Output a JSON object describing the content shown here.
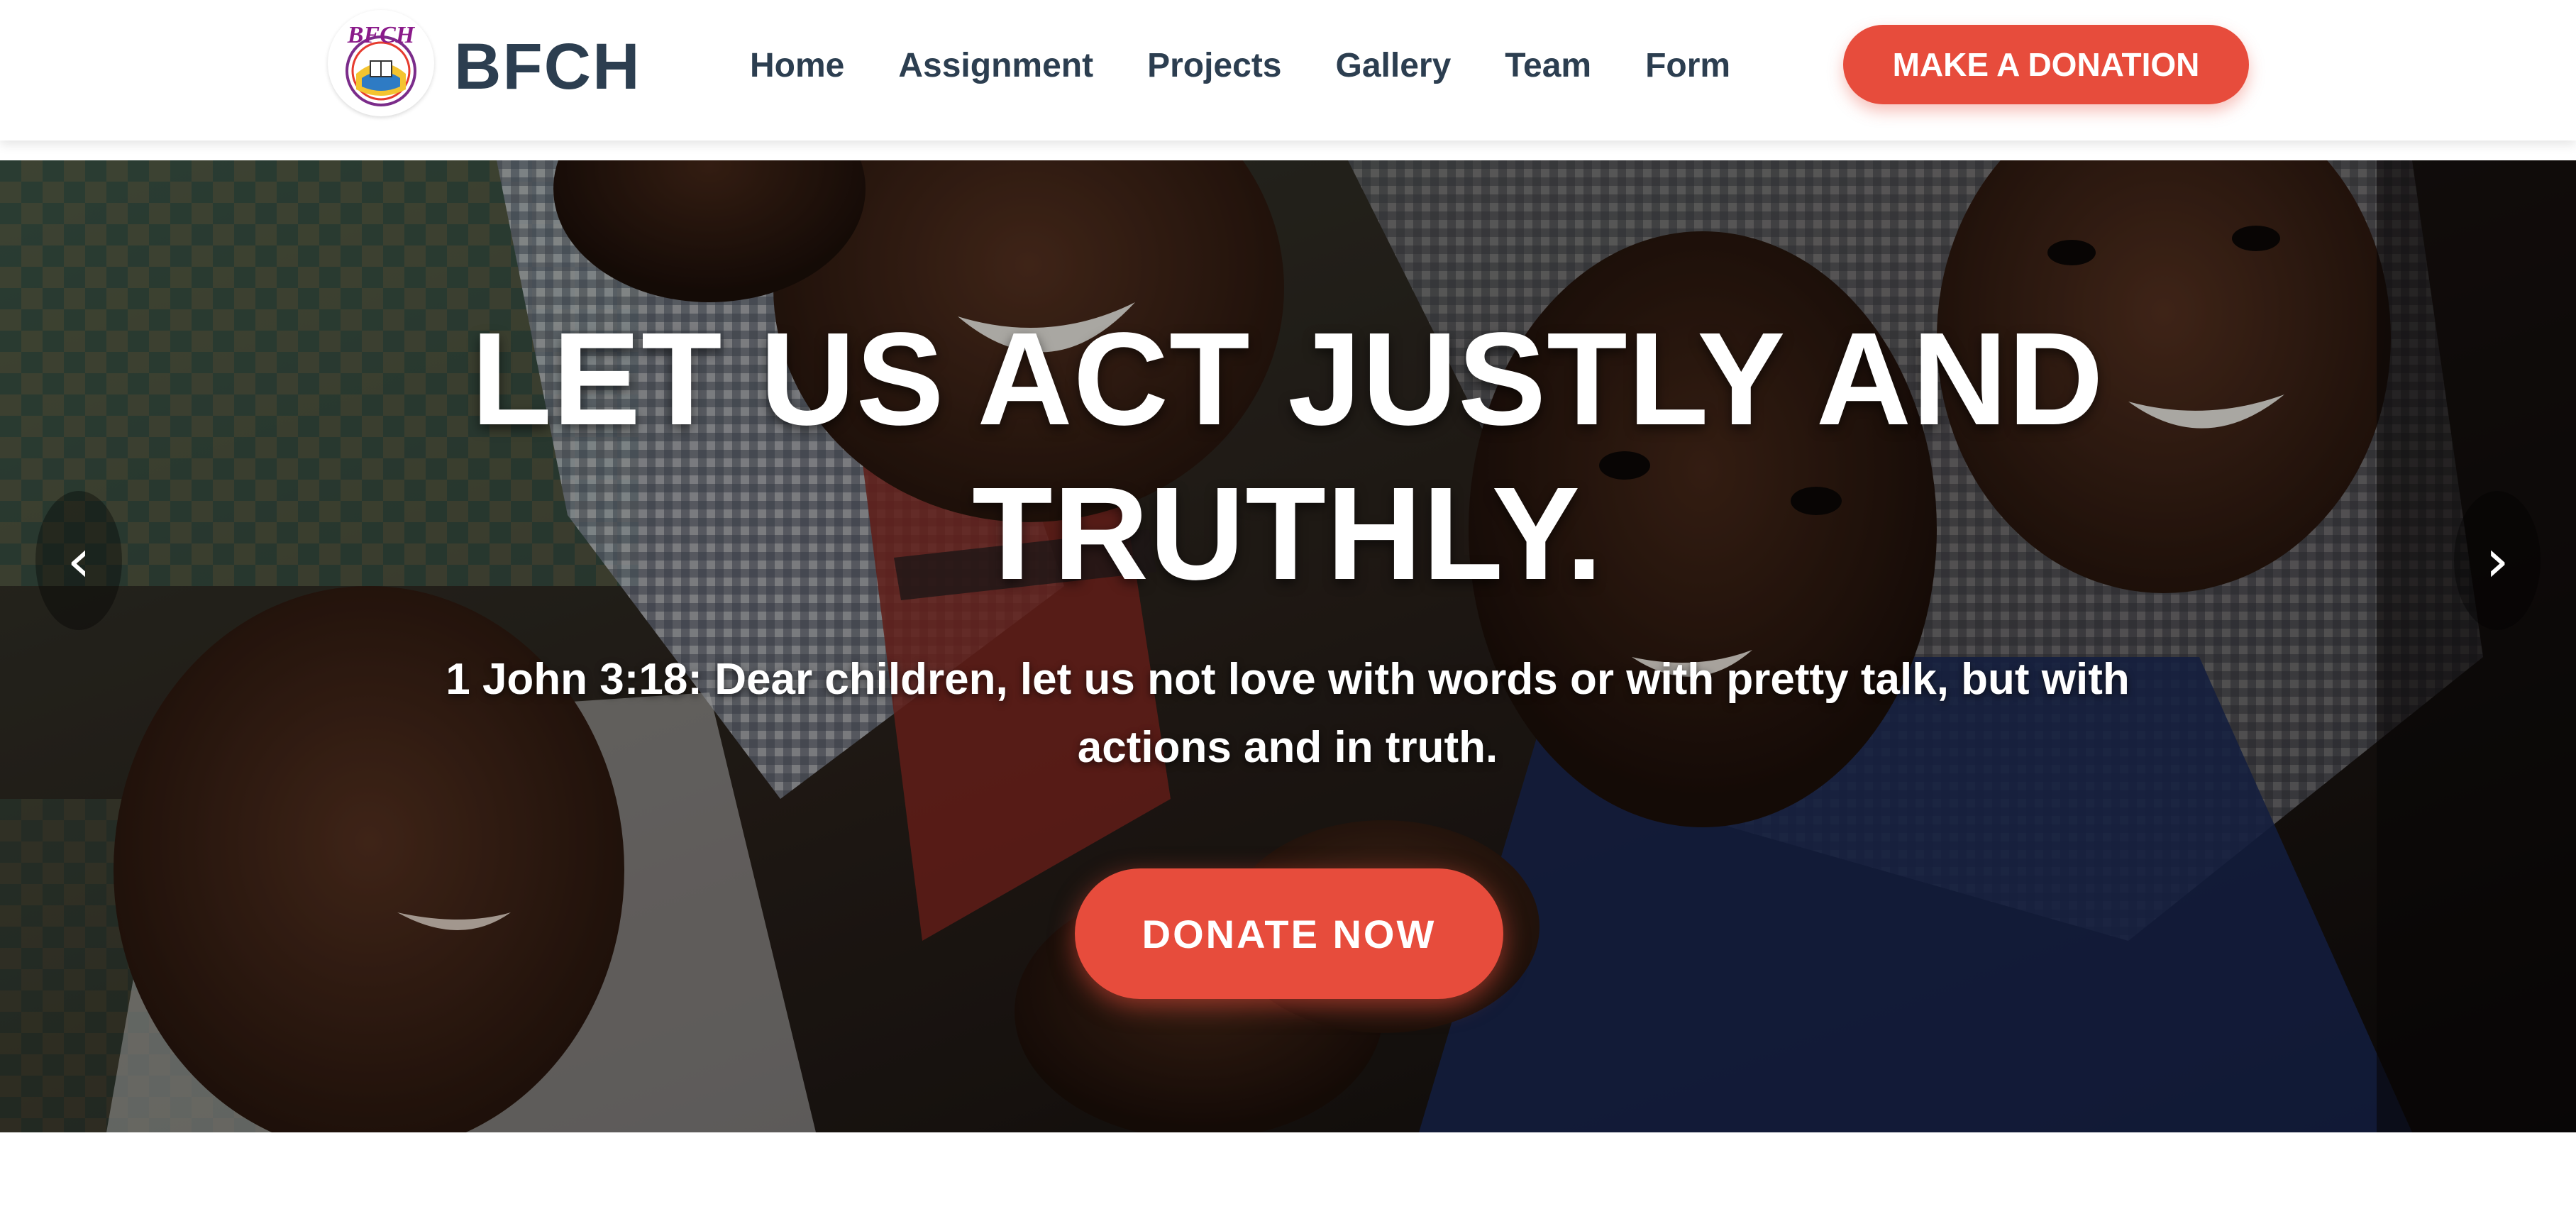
{
  "header": {
    "brand": "BFCH",
    "logo_text": "BFCH",
    "logo_icon": "bfch-logo-icon",
    "nav": [
      {
        "label": "Home"
      },
      {
        "label": "Assignment"
      },
      {
        "label": "Projects"
      },
      {
        "label": "Gallery"
      },
      {
        "label": "Team"
      },
      {
        "label": "Form"
      }
    ],
    "donation_button": "MAKE A DONATION"
  },
  "hero": {
    "title": "LET US ACT JUSTLY AND TRUTHLY.",
    "subtitle": "1 John 3:18: Dear children, let us not love with words or with pretty talk, but with actions and in truth.",
    "cta": "DONATE NOW",
    "prev_arrow": "‹",
    "next_arrow": "›",
    "image": "children-group-photo"
  },
  "colors": {
    "accent": "#e74c3c",
    "text_dark": "#2c3e50",
    "white": "#ffffff"
  }
}
